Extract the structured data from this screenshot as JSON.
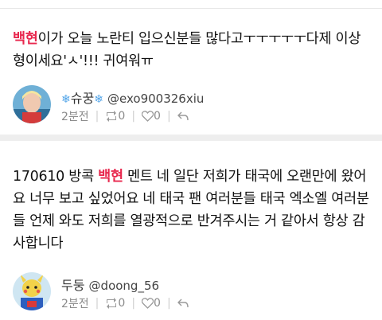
{
  "tweets": [
    {
      "text_prefix": "",
      "highlight": "백현",
      "text_rest": "이가 오늘 노란티 입으신분들 많다고ㅜㅜㅜㅜㅜ다제 이상형이세요'ㅅ'!!! 귀여워ㅠ",
      "user": {
        "snow_left": "❄",
        "display_name": "슈꿍",
        "snow_right": "❄",
        "handle": "@exo900326xiu"
      },
      "time": "2분전",
      "retweets": "0",
      "likes": "0"
    },
    {
      "text_prefix": "170610 방콕 ",
      "highlight": "백현",
      "text_rest": " 멘트 네 일단 저희가 태국에 오랜만에 왔어요 너무 보고 싶었어요 네 태국 팬 여러분들 태국 엑소엘 여러분들 언제 와도 저희를 열광적으로 반겨주시는 거 같아서 항상 감사합니다",
      "user": {
        "display_name": "두둥",
        "handle": "@doong_56"
      },
      "time": "2분전",
      "retweets": "0",
      "likes": "0"
    }
  ],
  "colors": {
    "highlight": "#e8284e",
    "meta_text": "#8a8a8a"
  },
  "icons": {
    "retweet": "retweet-icon",
    "like": "heart-icon",
    "reply": "reply-icon"
  }
}
